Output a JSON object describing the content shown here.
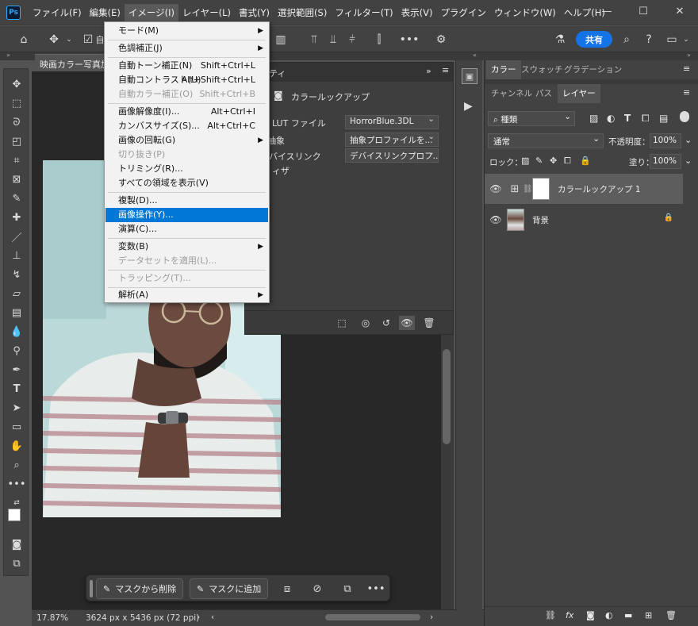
{
  "menubar": {
    "logo": "Ps",
    "items": [
      "ファイル(F)",
      "編集(E)",
      "イメージ(I)",
      "レイヤー(L)",
      "書式(Y)",
      "選択範囲(S)",
      "フィルター(T)",
      "表示(V)",
      "プラグイン",
      "ウィンドウ(W)",
      "ヘルプ(H)"
    ],
    "window_controls": [
      "—",
      "☐",
      "✕"
    ]
  },
  "optionsbar": {
    "share_label": "共有",
    "partial_checkbox_label": "自"
  },
  "document": {
    "tab_title": "映画カラー写真加工"
  },
  "status": {
    "zoom": "17.87%",
    "dimensions": "3624 px x 5436 px (72 ppi)"
  },
  "taskbar": {
    "remove_mask_label": "マスクから削除",
    "add_mask_label": "マスクに追加"
  },
  "properties": {
    "header_partial": "ティ",
    "layer_label": "カラールックアップ",
    "rows": [
      {
        "label": "D LUT ファイル",
        "value": "HorrorBlue.3DL"
      },
      {
        "label": "抽象",
        "value": "抽象プロファイルを..."
      },
      {
        "label": "バイスリンク",
        "value": "デバイスリンクプロフ..."
      },
      {
        "label": "ィザ",
        "value": ""
      }
    ]
  },
  "right_panel": {
    "top_tabs": [
      "カラー",
      "スウォッチ",
      "グラデーション"
    ],
    "layer_tabs": [
      "チャンネル",
      "パス",
      "レイヤー"
    ],
    "filter_kind": "種類",
    "blend_mode": "通常",
    "opacity_label": "不透明度：",
    "opacity_value": "100%",
    "lock_label": "ロック：",
    "fill_label": "塗り：",
    "fill_value": "100%",
    "layers": [
      {
        "name": "カラールックアップ 1",
        "selected": true
      },
      {
        "name": "背景",
        "selected": false,
        "locked": true
      }
    ]
  },
  "image_menu": {
    "items": [
      {
        "label": "モード(M)",
        "shortcut": "",
        "submenu": true,
        "disabled": false
      },
      {
        "label": "色調補正(J)",
        "shortcut": "",
        "submenu": true,
        "disabled": false
      },
      {
        "label": "自動トーン補正(N)",
        "shortcut": "Shift+Ctrl+L",
        "disabled": false
      },
      {
        "label": "自動コントラスト(U)",
        "shortcut": "Alt+Shift+Ctrl+L",
        "disabled": false
      },
      {
        "label": "自動カラー補正(O)",
        "shortcut": "Shift+Ctrl+B",
        "disabled": true
      },
      {
        "label": "画像解像度(I)...",
        "shortcut": "Alt+Ctrl+I",
        "disabled": false
      },
      {
        "label": "カンバスサイズ(S)...",
        "shortcut": "Alt+Ctrl+C",
        "disabled": false
      },
      {
        "label": "画像の回転(G)",
        "shortcut": "",
        "submenu": true,
        "disabled": false
      },
      {
        "label": "切り抜き(P)",
        "shortcut": "",
        "disabled": true
      },
      {
        "label": "トリミング(R)...",
        "shortcut": "",
        "disabled": false
      },
      {
        "label": "すべての領域を表示(V)",
        "shortcut": "",
        "disabled": false
      },
      {
        "label": "複製(D)...",
        "shortcut": "",
        "disabled": false
      },
      {
        "label": "画像操作(Y)...",
        "shortcut": "",
        "disabled": false,
        "highlight": true
      },
      {
        "label": "演算(C)...",
        "shortcut": "",
        "disabled": false
      },
      {
        "label": "変数(B)",
        "shortcut": "",
        "submenu": true,
        "disabled": false
      },
      {
        "label": "データセットを適用(L)...",
        "shortcut": "",
        "disabled": true
      },
      {
        "label": "トラッピング(T)...",
        "shortcut": "",
        "disabled": true
      },
      {
        "label": "解析(A)",
        "shortcut": "",
        "submenu": true,
        "disabled": false
      }
    ]
  },
  "colors": {
    "accent": "#0078d7",
    "share": "#1473e6"
  }
}
